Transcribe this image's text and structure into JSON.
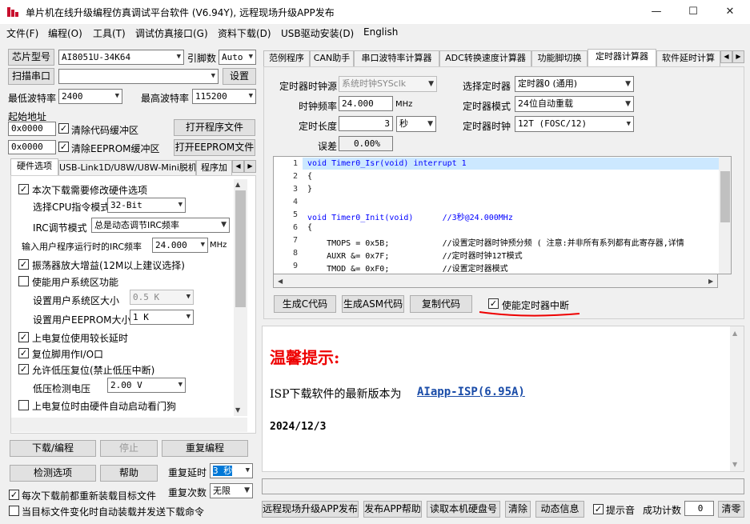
{
  "window": {
    "title": "单片机在线升级编程仿真调试平台软件 (V6.94Y), 远程现场升级APP发布",
    "min": "—",
    "max": "☐",
    "close": "✕"
  },
  "menu": [
    "文件(F)",
    "编程(O)",
    "工具(T)",
    "调试仿真接口(G)",
    "资料下载(D)",
    "USB驱动安装(D)",
    "English"
  ],
  "left": {
    "chip_label": "芯片型号",
    "chip_value": "AI8051U-34K64",
    "pin_label": "引脚数",
    "pin_value": "Auto",
    "scan_label": "扫描串口",
    "scan_value": "",
    "settings_label": "设置",
    "min_baud_label": "最低波特率",
    "min_baud": "2400",
    "max_baud_label": "最高波特率",
    "max_baud": "115200",
    "start_addr_label": "起始地址",
    "addr1": "0x0000",
    "clear_code": "清除代码缓冲区",
    "open_prog": "打开程序文件",
    "addr2": "0x0000",
    "clear_eeprom": "清除EEPROM缓冲区",
    "open_eeprom": "打开EEPROM文件",
    "tabs": [
      "硬件选项",
      "USB-Link1D/U8W/U8W-Mini脱机",
      "程序加"
    ],
    "hw": {
      "need_modify": "本次下载需要修改硬件选项",
      "cpu_mode_label": "选择CPU指令模式",
      "cpu_mode": "32-Bit",
      "irc_label": "IRC调节模式",
      "irc_mode": "总是动态调节IRC频率",
      "irc_freq_label": "输入用户程序运行时的IRC频率",
      "irc_freq": "24.000",
      "irc_unit": "MHz",
      "osc_gain": "振荡器放大增益(12M以上建议选择)",
      "user_sys": "使能用户系统区功能",
      "sys_size_label": "设置用户系统区大小",
      "sys_size": "0.5 K",
      "eeprom_size_label": "设置用户EEPROM大小",
      "eeprom_size": "1   K",
      "long_delay": "上电复位使用较长延时",
      "reset_io": "复位脚用作I/O口",
      "lvr": "允许低压复位(禁止低压中断)",
      "lvd_label": "低压检测电压",
      "lvd": "2.00 V",
      "wdt": "上电复位时由硬件自动启动看门狗"
    },
    "download": "下载/编程",
    "stop": "停止",
    "reprogram": "重复编程",
    "check": "检测选项",
    "help": "帮助",
    "repeat_delay_label": "重复延时",
    "repeat_delay": "3 秒",
    "repeat_count_label": "重复次数",
    "repeat_count": "无限",
    "reload": "每次下载前都重新装载目标文件",
    "auto_send": "当目标文件变化时自动装载并发送下载命令"
  },
  "right": {
    "tabs": [
      "范例程序",
      "CAN助手",
      "串口波特率计算器",
      "ADC转换速度计算器",
      "功能脚切换",
      "定时器计算器",
      "软件延时计算"
    ],
    "src_label": "定时器时钟源",
    "src": "系统时钟SYSclk",
    "sel_timer_label": "选择定时器",
    "sel_timer": "定时器0 (通用)",
    "freq_label": "时钟频率",
    "freq": "24.000",
    "freq_unit": "MHz",
    "mode_label": "定时器模式",
    "mode": "24位自动重载",
    "len_label": "定时长度",
    "len": "3",
    "len_unit": "秒",
    "clk_label": "定时器时钟",
    "clk": "12T (FOSC/12)",
    "err_label": "误差",
    "err": "0.00%",
    "code_lines": [
      {
        "n": "1",
        "t": "void Timer0_Isr(void) interrupt 1"
      },
      {
        "n": "2",
        "t": "{"
      },
      {
        "n": "3",
        "t": "}"
      },
      {
        "n": "4",
        "t": ""
      },
      {
        "n": "5",
        "t": "void Timer0_Init(void)      //3秒@24.000MHz"
      },
      {
        "n": "6",
        "t": "{"
      },
      {
        "n": "7",
        "t": "    TMOPS = 0x5B;           //设置定时器时钟预分频 ( 注意:并非所有系列都有此寄存器,详情"
      },
      {
        "n": "8",
        "t": "    AUXR &= 0x7F;           //定时器时钟12T模式"
      },
      {
        "n": "9",
        "t": "    TMOD &= 0xF0;           //设置定时器模式"
      }
    ],
    "gen_c": "生成C代码",
    "gen_asm": "生成ASM代码",
    "copy": "复制代码",
    "enable_int": "使能定时器中断",
    "tip_title": "温馨提示:",
    "tip_text": "ISP下载软件的最新版本为",
    "tip_link": "AIapp-ISP(6.95A)",
    "tip_date": "2024/12/3"
  },
  "bottom": {
    "remote": "远程现场升级APP发布",
    "publish_help": "发布APP帮助",
    "read_disk": "读取本机硬盘号",
    "clear": "清除",
    "dynamic": "动态信息",
    "sound": "提示音",
    "success_label": "成功计数",
    "success": "0",
    "clear_count": "清零"
  }
}
